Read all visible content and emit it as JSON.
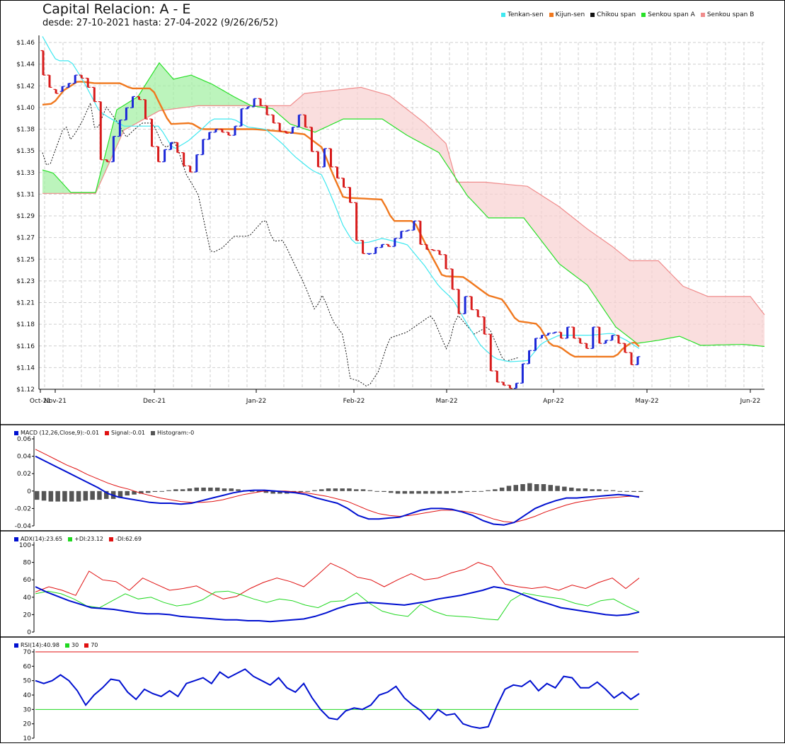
{
  "colors": {
    "tenkan": "#3fe8f0",
    "kijun": "#f0781e",
    "chikou": "#111111",
    "senkouA": "#28e028",
    "senkouB": "#f08c8c",
    "cloudA": "#9ff09f",
    "cloudB": "#f8d0d0",
    "up": "#1c28d8",
    "down": "#d81c1c",
    "macd": "#0010d0",
    "signal": "#e01010",
    "hist": "#555555",
    "adx": "#0010d0",
    "pdi": "#20d820",
    "mdi": "#e01010",
    "rsi": "#0010d0",
    "rsi30": "#20d820",
    "rsi70": "#e01010"
  },
  "header": {
    "title": "Capital Relacion: A - E",
    "subtitle": "desde: 27-10-2021 hasta: 27-04-2022 (9/26/26/52)"
  },
  "legend": [
    {
      "label": "Tenkan-sen",
      "color": "#3fe8f0"
    },
    {
      "label": "Kijun-sen",
      "color": "#f0781e"
    },
    {
      "label": "Chikou span",
      "color": "#111111"
    },
    {
      "label": "Senkou span A",
      "color": "#28e028"
    },
    {
      "label": "Senkou span B",
      "color": "#f08c8c"
    }
  ],
  "panels": {
    "macd": [
      {
        "label": "MACD (12,26,Close,9):-0.01",
        "color": "#0010d0"
      },
      {
        "label": "Signal:-0.01",
        "color": "#e01010"
      },
      {
        "label": "Histogram:-0",
        "color": "#555555"
      }
    ],
    "adx": [
      {
        "label": "ADX(14):23.65",
        "color": "#0010d0"
      },
      {
        "label": "+DI:23.12",
        "color": "#20d820"
      },
      {
        "label": "-DI:62.69",
        "color": "#e01010"
      }
    ],
    "rsi": [
      {
        "label": "RSI(14):40.98",
        "color": "#0010d0"
      },
      {
        "label": "30",
        "color": "#20d820"
      },
      {
        "label": "70",
        "color": "#e01010"
      }
    ]
  },
  "chart_data": [
    {
      "type": "ichimoku-ohlc",
      "title": "Capital Relacion: A - E",
      "subtitle": "desde: 27-10-2021 hasta: 27-04-2022 (9/26/26/52)",
      "yticks": [
        "$1.12",
        "$1.14",
        "$1.16",
        "$1.18",
        "$1.21",
        "$1.23",
        "$1.25",
        "$1.27",
        "$1.29",
        "$1.31",
        "$1.33",
        "$1.35",
        "$1.38",
        "$1.40",
        "$1.42",
        "$1.44",
        "$1.46"
      ],
      "ylim": [
        1.12,
        1.46
      ],
      "xticks": [
        "Oct-21",
        "Nov-21",
        "Dec-21",
        "Jan-22",
        "Feb-22",
        "Mar-22",
        "Apr-22",
        "May-22",
        "Jun-22"
      ],
      "grid": true,
      "legend_position": "top-right",
      "bars": [
        [
          1.452,
          1.428
        ],
        [
          1.428,
          1.416
        ],
        [
          1.414,
          1.41
        ],
        [
          1.412,
          1.417
        ],
        [
          1.416,
          1.42
        ],
        [
          1.42,
          1.428
        ],
        [
          1.428,
          1.425
        ],
        [
          1.425,
          1.416
        ],
        [
          1.416,
          1.402
        ],
        [
          1.402,
          1.345
        ],
        [
          1.345,
          1.343
        ],
        [
          1.343,
          1.368
        ],
        [
          1.368,
          1.384
        ],
        [
          1.384,
          1.396
        ],
        [
          1.396,
          1.407
        ],
        [
          1.407,
          1.404
        ],
        [
          1.404,
          1.385
        ],
        [
          1.385,
          1.358
        ],
        [
          1.358,
          1.343
        ],
        [
          1.343,
          1.355
        ],
        [
          1.355,
          1.362
        ],
        [
          1.362,
          1.352
        ],
        [
          1.352,
          1.339
        ],
        [
          1.339,
          1.333
        ],
        [
          1.333,
          1.35
        ],
        [
          1.35,
          1.365
        ],
        [
          1.365,
          1.372
        ],
        [
          1.372,
          1.375
        ],
        [
          1.375,
          1.372
        ],
        [
          1.372,
          1.369
        ],
        [
          1.369,
          1.378
        ],
        [
          1.378,
          1.395
        ],
        [
          1.395,
          1.397
        ],
        [
          1.397,
          1.405
        ],
        [
          1.405,
          1.398
        ],
        [
          1.398,
          1.389
        ],
        [
          1.389,
          1.381
        ],
        [
          1.381,
          1.373
        ],
        [
          1.373,
          1.371
        ],
        [
          1.371,
          1.377
        ],
        [
          1.377,
          1.389
        ],
        [
          1.389,
          1.377
        ],
        [
          1.377,
          1.353
        ],
        [
          1.353,
          1.338
        ],
        [
          1.338,
          1.356
        ],
        [
          1.356,
          1.338
        ],
        [
          1.338,
          1.327
        ],
        [
          1.327,
          1.318
        ],
        [
          1.318,
          1.303
        ],
        [
          1.303,
          1.266
        ],
        [
          1.266,
          1.253
        ],
        [
          1.253,
          1.253
        ],
        [
          1.253,
          1.259
        ],
        [
          1.259,
          1.262
        ],
        [
          1.262,
          1.26
        ],
        [
          1.26,
          1.268
        ],
        [
          1.268,
          1.275
        ],
        [
          1.275,
          1.276
        ],
        [
          1.276,
          1.285
        ],
        [
          1.285,
          1.262
        ],
        [
          1.262,
          1.257
        ],
        [
          1.257,
          1.256
        ],
        [
          1.256,
          1.252
        ],
        [
          1.252,
          1.238
        ],
        [
          1.238,
          1.218
        ],
        [
          1.218,
          1.194
        ],
        [
          1.194,
          1.211
        ],
        [
          1.211,
          1.198
        ],
        [
          1.198,
          1.191
        ],
        [
          1.191,
          1.174
        ],
        [
          1.174,
          1.138
        ],
        [
          1.138,
          1.127
        ],
        [
          1.127,
          1.124
        ],
        [
          1.124,
          1.121
        ],
        [
          1.121,
          1.126
        ],
        [
          1.126,
          1.145
        ],
        [
          1.145,
          1.158
        ],
        [
          1.158,
          1.17
        ],
        [
          1.17,
          1.173
        ],
        [
          1.173,
          1.175
        ],
        [
          1.175,
          1.176
        ],
        [
          1.176,
          1.17
        ],
        [
          1.17,
          1.181
        ],
        [
          1.181,
          1.17
        ],
        [
          1.17,
          1.165
        ],
        [
          1.165,
          1.16
        ],
        [
          1.16,
          1.181
        ],
        [
          1.181,
          1.165
        ],
        [
          1.165,
          1.168
        ],
        [
          1.168,
          1.173
        ],
        [
          1.173,
          1.165
        ],
        [
          1.165,
          1.156
        ],
        [
          1.156,
          1.144
        ],
        [
          1.144,
          1.152
        ]
      ]
    },
    {
      "type": "macd",
      "ylim": [
        -0.04,
        0.06
      ],
      "yticks": [
        "-0.04",
        "-0.02",
        "0",
        "0.02",
        "0.04",
        "0.06"
      ],
      "macd": [
        0.04,
        0.034,
        0.028,
        0.022,
        0.016,
        0.01,
        0.004,
        -0.003,
        -0.007,
        -0.009,
        -0.011,
        -0.013,
        -0.014,
        -0.014,
        -0.015,
        -0.014,
        -0.011,
        -0.008,
        -0.005,
        -0.002,
        0.0,
        0.001,
        0.001,
        0.0,
        -0.001,
        -0.002,
        -0.004,
        -0.008,
        -0.011,
        -0.014,
        -0.02,
        -0.028,
        -0.032,
        -0.032,
        -0.031,
        -0.03,
        -0.026,
        -0.022,
        -0.02,
        -0.02,
        -0.021,
        -0.024,
        -0.028,
        -0.034,
        -0.038,
        -0.039,
        -0.036,
        -0.028,
        -0.02,
        -0.015,
        -0.011,
        -0.008,
        -0.008,
        -0.007,
        -0.006,
        -0.005,
        -0.004,
        -0.005,
        -0.007
      ],
      "signal": [
        0.048,
        0.042,
        0.036,
        0.03,
        0.025,
        0.019,
        0.014,
        0.009,
        0.005,
        0.002,
        -0.002,
        -0.005,
        -0.008,
        -0.01,
        -0.012,
        -0.013,
        -0.013,
        -0.012,
        -0.01,
        -0.007,
        -0.004,
        -0.002,
        0.0,
        0.0,
        0.0,
        -0.001,
        -0.002,
        -0.004,
        -0.006,
        -0.009,
        -0.012,
        -0.017,
        -0.022,
        -0.026,
        -0.028,
        -0.029,
        -0.028,
        -0.026,
        -0.024,
        -0.022,
        -0.022,
        -0.023,
        -0.025,
        -0.028,
        -0.032,
        -0.035,
        -0.036,
        -0.033,
        -0.029,
        -0.024,
        -0.02,
        -0.016,
        -0.013,
        -0.011,
        -0.009,
        -0.008,
        -0.007,
        -0.006,
        -0.006
      ],
      "histogram": [
        -0.01,
        -0.011,
        -0.012,
        -0.012,
        -0.012,
        -0.012,
        -0.012,
        -0.011,
        -0.01,
        -0.01,
        -0.009,
        -0.009,
        -0.007,
        -0.005,
        -0.004,
        -0.003,
        -0.002,
        -0.001,
        0.0,
        0.001,
        0.002,
        0.002,
        0.003,
        0.004,
        0.004,
        0.004,
        0.004,
        0.003,
        0.003,
        0.002,
        0.001,
        0.0,
        -0.001,
        -0.002,
        -0.003,
        -0.003,
        -0.003,
        -0.002,
        -0.001,
        0.0,
        0.001,
        0.002,
        0.003,
        0.003,
        0.003,
        0.003,
        0.002,
        0.002,
        0.001,
        0.0,
        -0.001,
        -0.002,
        -0.003,
        -0.003,
        -0.003,
        -0.003,
        -0.003,
        -0.003,
        -0.003,
        -0.003,
        -0.002,
        -0.002,
        -0.001,
        -0.001,
        0.0,
        0.001,
        0.002,
        0.004,
        0.006,
        0.007,
        0.008,
        0.009,
        0.008,
        0.008,
        0.007,
        0.006,
        0.005,
        0.004,
        0.003,
        0.003,
        0.002,
        0.002,
        0.001,
        0.001,
        0.0,
        0.0,
        -0.001,
        -0.001
      ]
    },
    {
      "type": "adx",
      "ylim": [
        0,
        100
      ],
      "yticks": [
        "0",
        "20",
        "40",
        "60",
        "80",
        "100"
      ],
      "adx": [
        52,
        46,
        41,
        36,
        32,
        28,
        27,
        26,
        24,
        22,
        21,
        21,
        20,
        18,
        17,
        16,
        15,
        14,
        14,
        13,
        13,
        12,
        13,
        14,
        15,
        18,
        22,
        27,
        31,
        33,
        34,
        33,
        32,
        31,
        33,
        35,
        38,
        40,
        42,
        45,
        48,
        52,
        50,
        46,
        41,
        36,
        32,
        28,
        26,
        24,
        22,
        20,
        19,
        20,
        23
      ],
      "pdi": [
        44,
        47,
        44,
        38,
        30,
        28,
        36,
        44,
        38,
        40,
        34,
        30,
        32,
        37,
        46,
        47,
        43,
        38,
        34,
        38,
        36,
        31,
        28,
        35,
        36,
        45,
        33,
        24,
        20,
        18,
        32,
        24,
        19,
        18,
        17,
        15,
        14,
        36,
        45,
        42,
        40,
        38,
        33,
        30,
        36,
        38,
        30,
        23
      ],
      "mdi": [
        46,
        52,
        48,
        42,
        70,
        60,
        58,
        48,
        62,
        55,
        48,
        50,
        53,
        45,
        38,
        41,
        50,
        57,
        62,
        58,
        52,
        65,
        79,
        72,
        63,
        60,
        52,
        60,
        67,
        60,
        62,
        68,
        72,
        80,
        75,
        55,
        52,
        50,
        52,
        48,
        54,
        50,
        57,
        62,
        50,
        62
      ]
    },
    {
      "type": "rsi",
      "ylim": [
        10,
        70
      ],
      "yticks": [
        "10",
        "20",
        "30",
        "40",
        "50",
        "60",
        "70"
      ],
      "levels": [
        30,
        70
      ],
      "rsi": [
        50,
        48,
        50,
        54,
        50,
        43,
        33,
        40,
        45,
        51,
        50,
        42,
        37,
        44,
        41,
        39,
        43,
        39,
        48,
        50,
        52,
        48,
        56,
        52,
        55,
        58,
        53,
        50,
        47,
        52,
        45,
        42,
        48,
        38,
        30,
        24,
        23,
        29,
        31,
        30,
        33,
        40,
        42,
        46,
        38,
        33,
        29,
        23,
        30,
        26,
        27,
        20,
        18,
        17,
        18,
        32,
        44,
        47,
        46,
        50,
        43,
        48,
        45,
        53,
        52,
        45,
        45,
        49,
        44,
        38,
        42,
        37,
        41
      ]
    }
  ]
}
